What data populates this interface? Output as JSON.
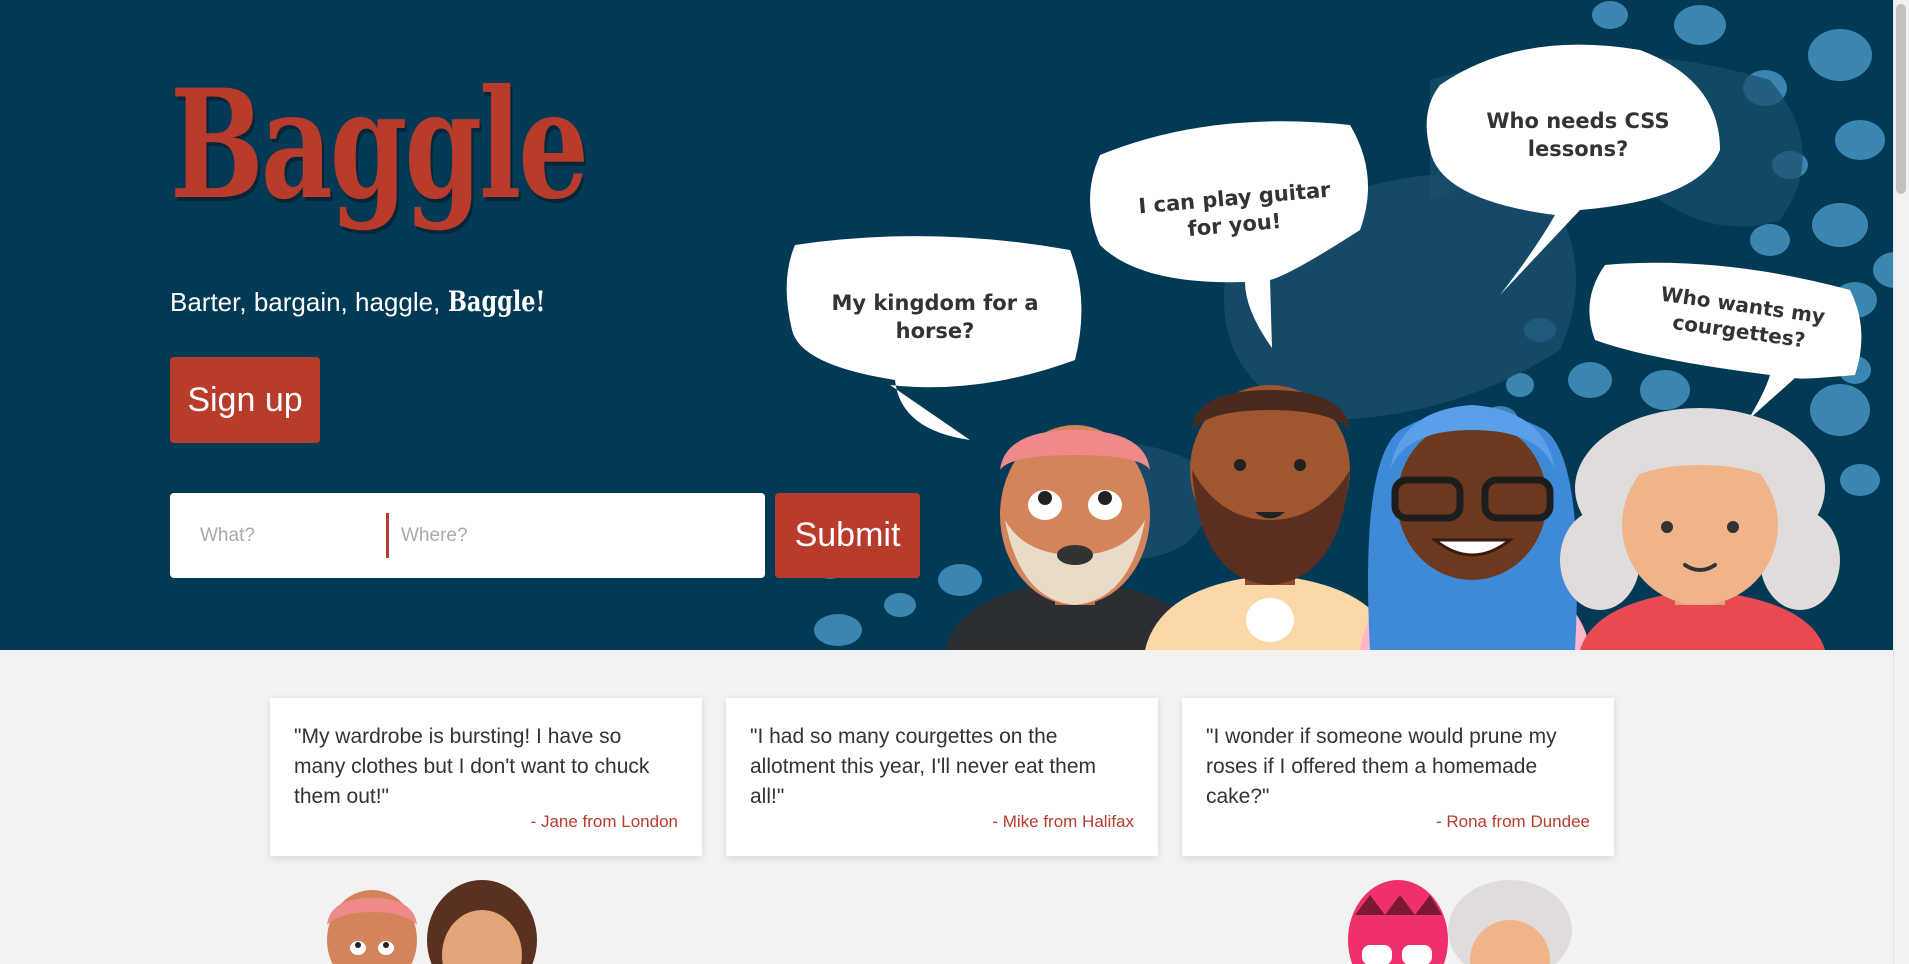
{
  "hero": {
    "brand": "Baggle",
    "tagline_prefix": "Barter, bargain, haggle, ",
    "tagline_brand": "Baggle!",
    "signup_label": "Sign up",
    "search": {
      "what_placeholder": "What?",
      "where_placeholder": "Where?",
      "submit_label": "Submit"
    },
    "bubbles": [
      {
        "line1": "My kingdom for a",
        "line2": "horse?"
      },
      {
        "line1": "I can play guitar",
        "line2": "for you!"
      },
      {
        "line1": "Who needs CSS",
        "line2": "lessons?"
      },
      {
        "line1": "Who wants my",
        "line2": "courgettes?"
      }
    ]
  },
  "testimonials": [
    {
      "quote": "\"My wardrobe is bursting! I have so many clothes but I don't want to chuck them out!\"",
      "author": "- Jane from London"
    },
    {
      "quote": "\"I had so many courgettes on the allotment this year, I'll never eat them all!\"",
      "author": "- Mike from Halifax"
    },
    {
      "quote": "\"I wonder if someone would prune my roses if I offered them a homemade cake?\"",
      "author": "- Rona from Dundee"
    }
  ],
  "colors": {
    "hero_bg": "#023a55",
    "accent": "#b83b2c",
    "page_bg": "#f2f2f2"
  }
}
